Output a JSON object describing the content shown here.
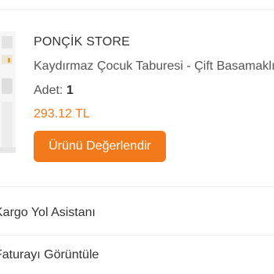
{
  "order_item": {
    "store_name": "PONÇİK STORE",
    "product_name": "Kaydırmaz Çocuk Taburesi - Çift Basamaklı",
    "quantity_label": "Adet:",
    "quantity_value": "1",
    "price": "293.12 TL",
    "review_button_label": "Ürünü Değerlendir",
    "image_icon": "product-thumbnail"
  },
  "menu": {
    "items": [
      {
        "label": "Kargo Yol Asistanı"
      },
      {
        "label": "Faturayı Görüntüle"
      }
    ]
  },
  "colors": {
    "accent": "#f27a1a",
    "text_primary": "#333333",
    "text_secondary": "#555555",
    "divider": "#ececec"
  }
}
